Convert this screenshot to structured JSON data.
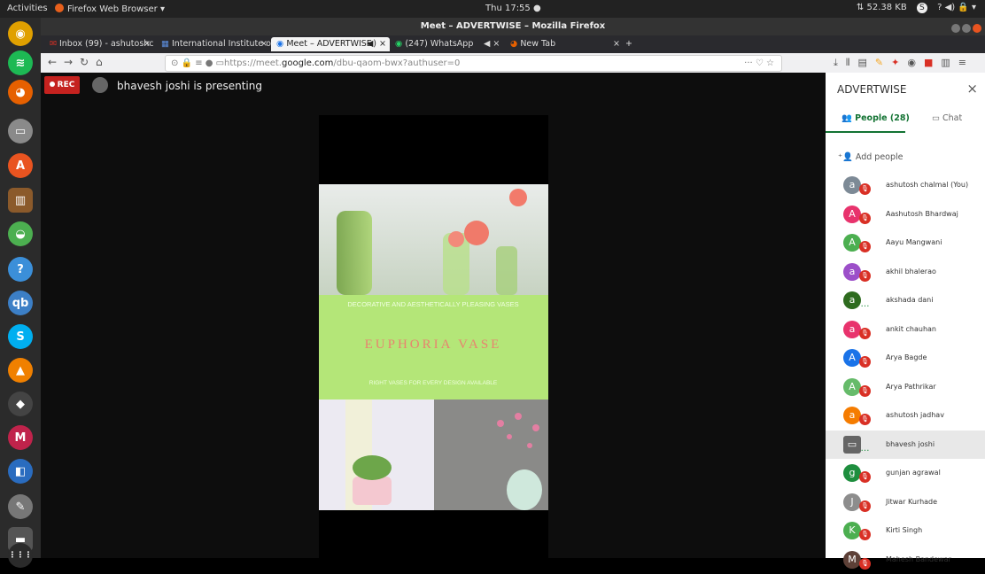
{
  "system_bar": {
    "activities": "Activities",
    "app_name": "Firefox Web Browser ▾",
    "clock": "Thu 17:55 ●",
    "network": "⇅ 52.38 KB",
    "indicators": "?  ◀)  🔒 ▾"
  },
  "dock": {
    "items": [
      {
        "icon": "chrome-icon",
        "glyph": "◉",
        "color": "#e0a000"
      },
      {
        "icon": "spotify-icon",
        "glyph": "≋",
        "color": "#1db954"
      },
      {
        "icon": "firefox-icon",
        "glyph": "◕",
        "color": "#e66000"
      },
      {
        "icon": "files-icon",
        "glyph": "▭",
        "color": "#8a8a8a"
      },
      {
        "icon": "software-center-icon",
        "glyph": "A",
        "color": "#e95420"
      },
      {
        "icon": "library-icon",
        "glyph": "▥",
        "color": "#8b5a2b"
      },
      {
        "icon": "cloud-icon",
        "glyph": "◒",
        "color": "#4caf50"
      },
      {
        "icon": "help-icon",
        "glyph": "?",
        "color": "#3b8fd9"
      },
      {
        "icon": "qbittorrent-icon",
        "glyph": "qb",
        "color": "#3c7fc6"
      },
      {
        "icon": "skype-icon",
        "glyph": "S",
        "color": "#00aff0"
      },
      {
        "icon": "vlc-icon",
        "glyph": "▲",
        "color": "#f08000"
      },
      {
        "icon": "inkscape-icon",
        "glyph": "◆",
        "color": "#444"
      },
      {
        "icon": "mendeley-icon",
        "glyph": "M",
        "color": "#c0234b"
      },
      {
        "icon": "virtualbox-icon",
        "glyph": "◧",
        "color": "#2a6cbf"
      },
      {
        "icon": "text-editor-icon",
        "glyph": "✎",
        "color": "#777"
      },
      {
        "icon": "drive-icon",
        "glyph": "▬",
        "color": "#555"
      },
      {
        "icon": "app-grid-icon",
        "glyph": "⋮⋮⋮",
        "color": "#2b2b2b"
      }
    ]
  },
  "window": {
    "title": "Meet – ADVERTWISE – Mozilla Firefox"
  },
  "tabs": [
    {
      "label": "Inbox (99) - ashutoshc",
      "active": false,
      "icon": "gmail-icon"
    },
    {
      "label": "International Institute o",
      "active": false,
      "icon": "institute-icon"
    },
    {
      "label": "Meet – ADVERTWISE",
      "active": true,
      "icon": "meet-icon"
    },
    {
      "label": "(247) WhatsApp",
      "active": false,
      "icon": "whatsapp-icon"
    },
    {
      "label": "",
      "active": false,
      "icon": "muted-icon"
    },
    {
      "label": "New Tab",
      "active": false,
      "icon": "firefox-icon"
    }
  ],
  "nav": {
    "url_host": "https://meet.",
    "url_domain": "google.com",
    "url_path": "/dbu-qaom-bwx?authuser=0",
    "page_actions": "···  ♡  ☆"
  },
  "meet": {
    "rec_label": "REC",
    "presenter_text": "bhavesh joshi is presenting",
    "slide_text_1": "DECORATIVE AND AESTHETICALLY PLEASING VASES",
    "slide_text_2": "EUPHORIA VASE",
    "slide_text_3": "RIGHT VASES FOR EVERY DESIGN AVAILABLE"
  },
  "panel": {
    "title": "ADVERTWISE",
    "people_tab": "People (28)",
    "chat_tab": "Chat",
    "add_people": "Add people",
    "participants": [
      {
        "initial": "a",
        "name": "ashutosh chalmal (You)",
        "color": "#7d8a96",
        "status": "muted"
      },
      {
        "initial": "A",
        "name": "Aashutosh Bhardwaj",
        "color": "#e8336d",
        "status": "muted"
      },
      {
        "initial": "A",
        "name": "Aayu Mangwani",
        "color": "#4caf50",
        "status": "muted"
      },
      {
        "initial": "a",
        "name": "akhil bhalerao",
        "color": "#9c4fc9",
        "status": "muted"
      },
      {
        "initial": "a",
        "name": "akshada dani",
        "color": "#2e6b1f",
        "status": "talking"
      },
      {
        "initial": "a",
        "name": "ankit chauhan",
        "color": "#e8336d",
        "status": "muted"
      },
      {
        "initial": "A",
        "name": "Arya Bagde",
        "color": "#1a73e8",
        "status": "muted"
      },
      {
        "initial": "A",
        "name": "Arya Pathrikar",
        "color": "#66bb6a",
        "status": "muted"
      },
      {
        "initial": "a",
        "name": "ashutosh jadhav",
        "color": "#f57c00",
        "status": "muted"
      },
      {
        "initial": "▭",
        "name": "bhavesh joshi",
        "color": "#666",
        "status": "presenting"
      },
      {
        "initial": "g",
        "name": "gunjan agrawal",
        "color": "#1e8e3e",
        "status": "muted"
      },
      {
        "initial": "J",
        "name": "Jitwar Kurhade",
        "color": "#8d8d8d",
        "status": "muted"
      },
      {
        "initial": "K",
        "name": "Kirti Singh",
        "color": "#4caf50",
        "status": "muted"
      },
      {
        "initial": "M",
        "name": "Mahesh Bandewar",
        "color": "#5d4037",
        "status": "muted"
      }
    ]
  }
}
